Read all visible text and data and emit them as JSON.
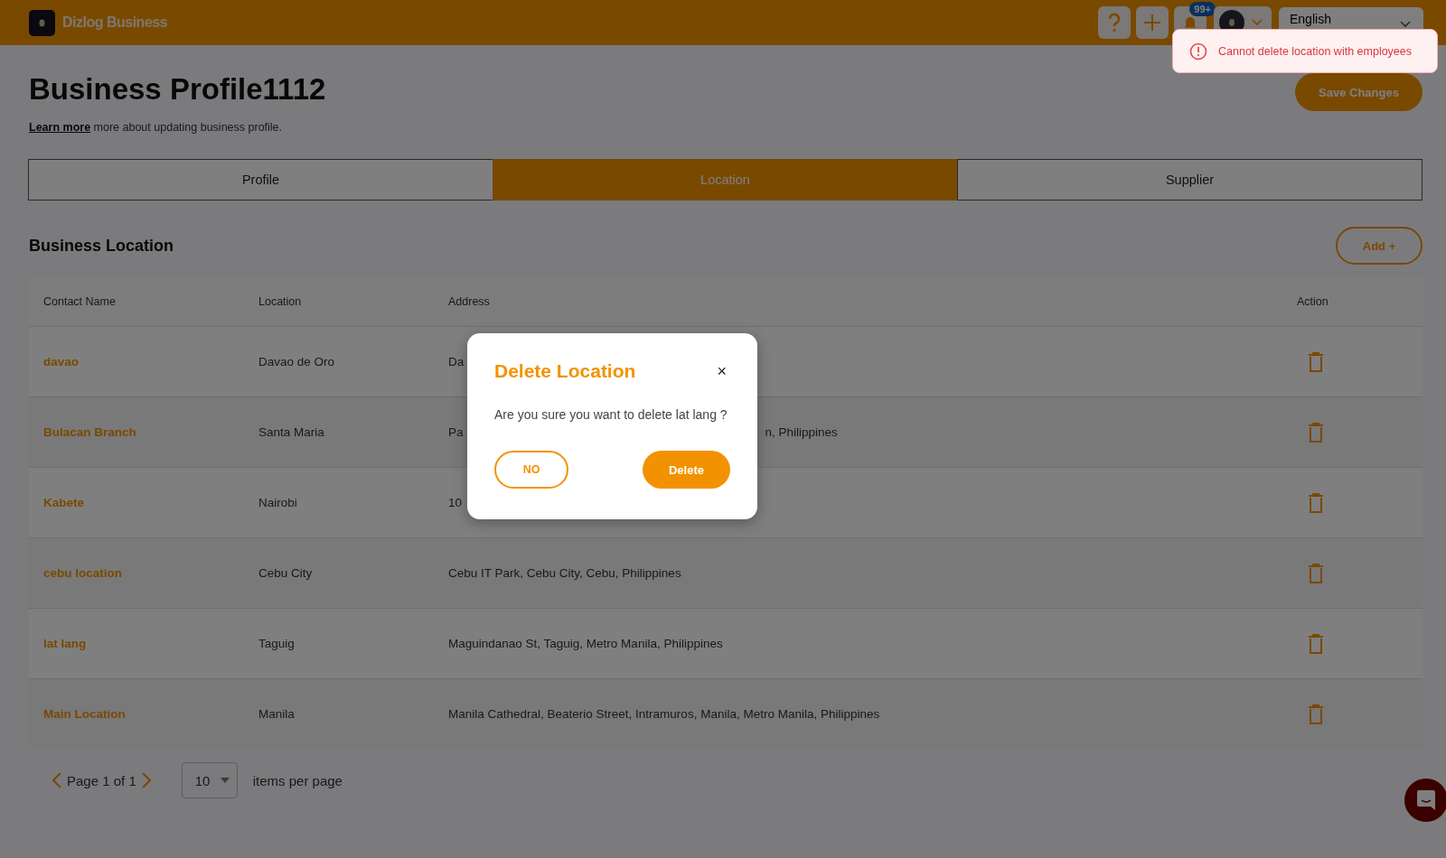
{
  "app": {
    "name": "Dizlog Business",
    "notification_count": "99+",
    "language": "English"
  },
  "toast": {
    "message": "Cannot delete location with employees"
  },
  "page": {
    "title": "Business Profile1112",
    "learn_more": "Learn more",
    "subtitle": " more about updating business profile.",
    "save_button": "Save Changes"
  },
  "tabs": [
    {
      "label": "Profile",
      "selected": false
    },
    {
      "label": "Location",
      "selected": true
    },
    {
      "label": "Supplier",
      "selected": false
    }
  ],
  "section": {
    "title": "Business Location",
    "add_button": "Add +"
  },
  "table": {
    "columns": [
      "Contact Name",
      "Location",
      "Address",
      "Action"
    ],
    "rows": [
      {
        "contact": "davao",
        "location": "Davao de Oro",
        "address_parts": [
          "Da"
        ]
      },
      {
        "contact": "Bulacan Branch",
        "location": "Santa Maria",
        "address_parts": [
          "Pa",
          "n, Philippines"
        ]
      },
      {
        "contact": "Kabete",
        "location": "Nairobi",
        "address_parts": [
          "10"
        ]
      },
      {
        "contact": "cebu location",
        "location": "Cebu City",
        "address_parts": [
          "Cebu IT Park, Cebu City, Cebu, Philippines"
        ]
      },
      {
        "contact": "lat lang",
        "location": "Taguig",
        "address_parts": [
          "Maguindanao St, Taguig, Metro Manila, Philippines"
        ]
      },
      {
        "contact": "Main Location",
        "location": "Manila",
        "address_parts": [
          "Manila Cathedral, Beaterio Street, Intramuros, Manila, Metro Manila, Philippines"
        ]
      }
    ]
  },
  "pagination": {
    "page_label": "Page 1 of 1",
    "per_page": "10",
    "per_page_label": "items per page"
  },
  "dialog": {
    "title": "Delete Location",
    "close": "×",
    "message": "Are you sure you want to delete lat lang ?",
    "cancel": "NO",
    "confirm": "Delete"
  }
}
